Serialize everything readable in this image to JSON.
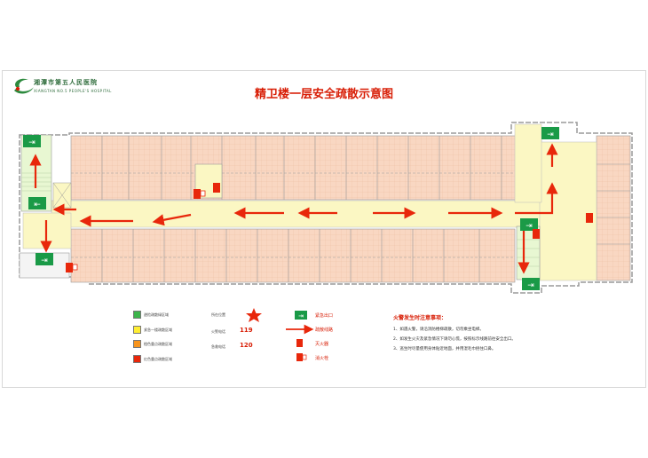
{
  "title": "精卫楼一层安全疏散示意图",
  "hospital": {
    "name": "湘潭市第五人民医院",
    "name_en": "XIANGTAN NO.5 PEOPLE'S HOSPITAL"
  },
  "colors": {
    "room_fill": "#f9d7c2",
    "corridor_fill": "#fbf7c3",
    "stair_fill": "#e8f7d2",
    "exit_green": "#1a9a47",
    "accent_red": "#e8270b"
  },
  "zone_legend": [
    {
      "color": "#3cb44b",
      "label": "避险疏散绿区域"
    },
    {
      "color": "#ffee33",
      "label": "紧急一楼疏散区域"
    },
    {
      "color": "#f7941d",
      "label": "橙色重点疏散区域"
    },
    {
      "color": "#e8270b",
      "label": "红色重点疏散区域"
    }
  ],
  "info": [
    {
      "label": "所在位置",
      "value": "★",
      "icon": "star-icon"
    },
    {
      "label": "火警电话",
      "value": "119"
    },
    {
      "label": "急救电话",
      "value": "120"
    }
  ],
  "symbols": [
    {
      "icon": "emergency-exit-icon",
      "label": "紧急出口"
    },
    {
      "icon": "evacuation-arrow-icon",
      "label": "疏散线路"
    },
    {
      "icon": "fire-extinguisher-icon",
      "label": "灭火器"
    },
    {
      "icon": "fire-hydrant-icon",
      "label": "消火栓"
    }
  ],
  "notes": {
    "title": "火警发生时注意事项：",
    "items": [
      "1、如遇火警，请沿消防楼梯疏散，切勿乘坐电梯。",
      "2、如发生火灾及紧急情况下请勿心慌，按照标示线路前往安全出口。",
      "3、逃生时尽量使用身体贴近地面，并用湿毛巾捂住口鼻。"
    ]
  }
}
